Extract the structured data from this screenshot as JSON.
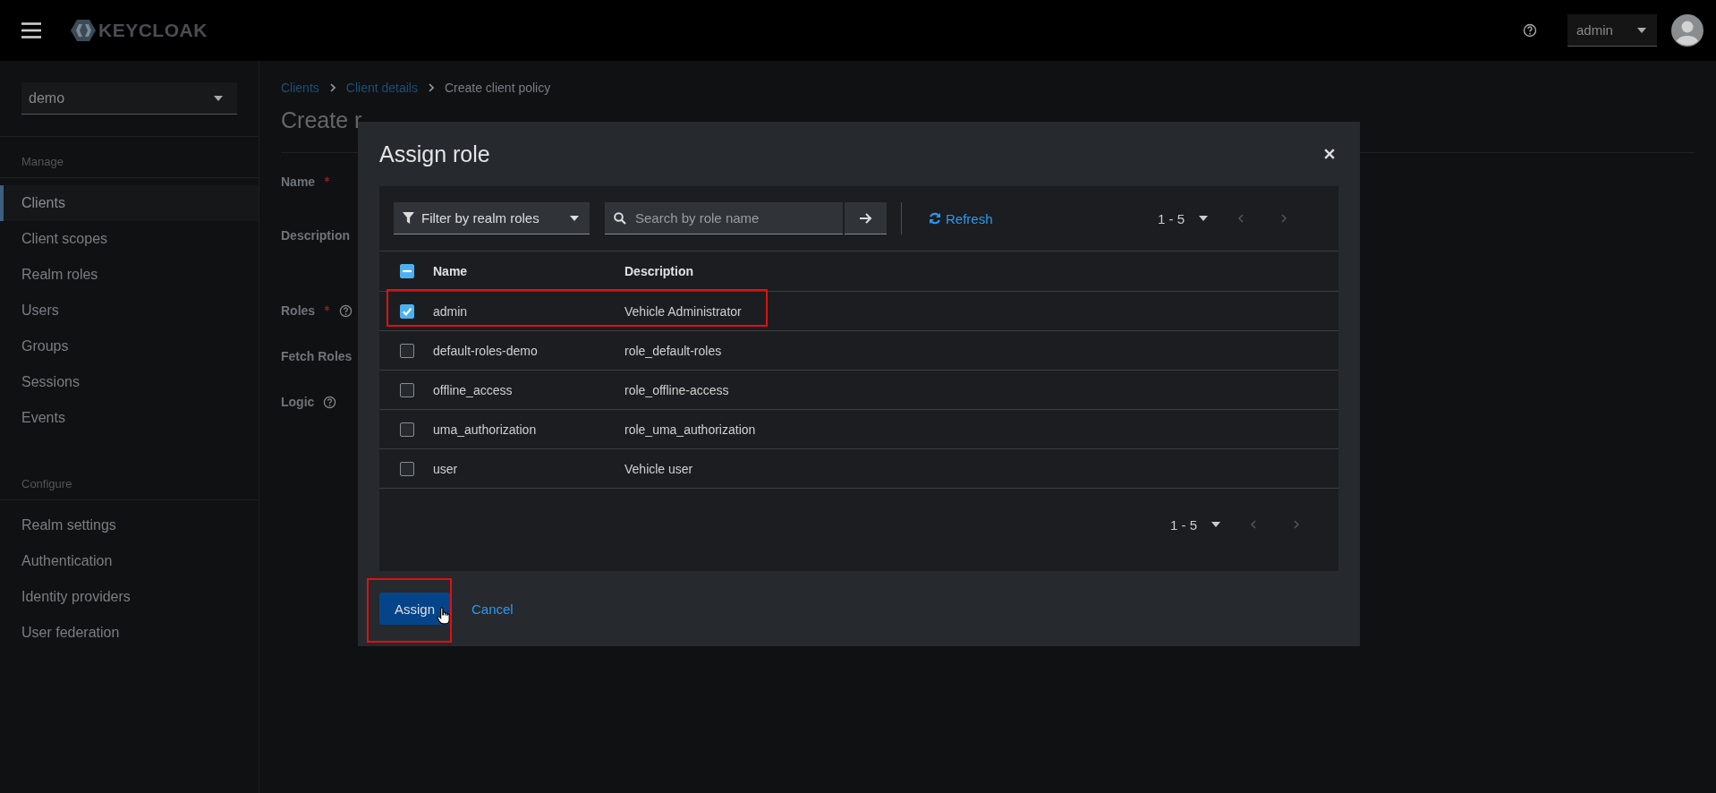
{
  "header": {
    "brand": "KEYCLOAK",
    "user": "admin"
  },
  "sidebar": {
    "realm": "demo",
    "sections": [
      {
        "heading": "Manage",
        "items": [
          {
            "label": "Clients",
            "selected": true
          },
          {
            "label": "Client scopes",
            "selected": false
          },
          {
            "label": "Realm roles",
            "selected": false
          },
          {
            "label": "Users",
            "selected": false
          },
          {
            "label": "Groups",
            "selected": false
          },
          {
            "label": "Sessions",
            "selected": false
          },
          {
            "label": "Events",
            "selected": false
          }
        ]
      },
      {
        "heading": "Configure",
        "items": [
          {
            "label": "Realm settings",
            "selected": false
          },
          {
            "label": "Authentication",
            "selected": false
          },
          {
            "label": "Identity providers",
            "selected": false
          },
          {
            "label": "User federation",
            "selected": false
          }
        ]
      }
    ]
  },
  "breadcrumb": [
    {
      "label": "Clients",
      "kind": "link"
    },
    {
      "label": "Client details",
      "kind": "link"
    },
    {
      "label": "Create client policy",
      "kind": "current"
    }
  ],
  "page_title": "Create r",
  "form": [
    {
      "label": "Name",
      "required": true,
      "help": false
    },
    {
      "label": "Description"
    },
    {
      "label": "Roles",
      "required": true,
      "help": true
    },
    {
      "label": "Fetch Roles"
    },
    {
      "label": "Logic",
      "required": false,
      "help": true
    }
  ],
  "modal": {
    "title": "Assign role",
    "filter": "Filter by realm roles",
    "search": {
      "placeholder": "Search by role name"
    },
    "refresh": "Refresh",
    "pagination_top": "1 - 5",
    "select_all": {
      "indeterminate": true
    },
    "columns": [
      "Name",
      "Description"
    ],
    "rows": [
      {
        "name": "admin",
        "description": "Vehicle Administrator",
        "checked": true,
        "highlighted": true
      },
      {
        "name": "default-roles-demo",
        "description": "role_default-roles",
        "checked": false,
        "highlighted": false
      },
      {
        "name": "offline_access",
        "description": "role_offline-access",
        "checked": false,
        "highlighted": false
      },
      {
        "name": "uma_authorization",
        "description": "role_uma_authorization",
        "checked": false,
        "highlighted": false
      },
      {
        "name": "user",
        "description": "Vehicle user",
        "checked": false,
        "highlighted": false
      }
    ],
    "pagination_bottom": "1 - 5",
    "assign": {
      "label": "Assign",
      "highlighted": true
    },
    "cancel": "Cancel"
  }
}
